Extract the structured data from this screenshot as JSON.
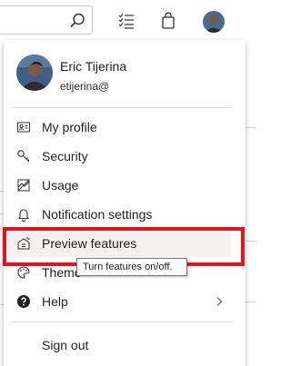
{
  "header": {
    "icons": [
      "search-icon",
      "task-list-icon",
      "shopping-bag-icon",
      "avatar"
    ]
  },
  "profile": {
    "name": "Eric Tijerina",
    "email": "etijerina@"
  },
  "menu": {
    "items": [
      {
        "label": "My profile",
        "icon": "contact-card-icon"
      },
      {
        "label": "Security",
        "icon": "key-icon"
      },
      {
        "label": "Usage",
        "icon": "usage-icon"
      },
      {
        "label": "Notification settings",
        "icon": "bell-icon"
      },
      {
        "label": "Preview features",
        "icon": "preview-features-icon"
      },
      {
        "label": "Theme",
        "icon": "palette-icon"
      },
      {
        "label": "Help",
        "icon": "help-icon"
      }
    ],
    "sign_out": "Sign out"
  },
  "tooltip": {
    "text": "Turn features on/off."
  },
  "colors": {
    "highlight": "#e81123",
    "active_item_bg": "#f3f2f1"
  }
}
